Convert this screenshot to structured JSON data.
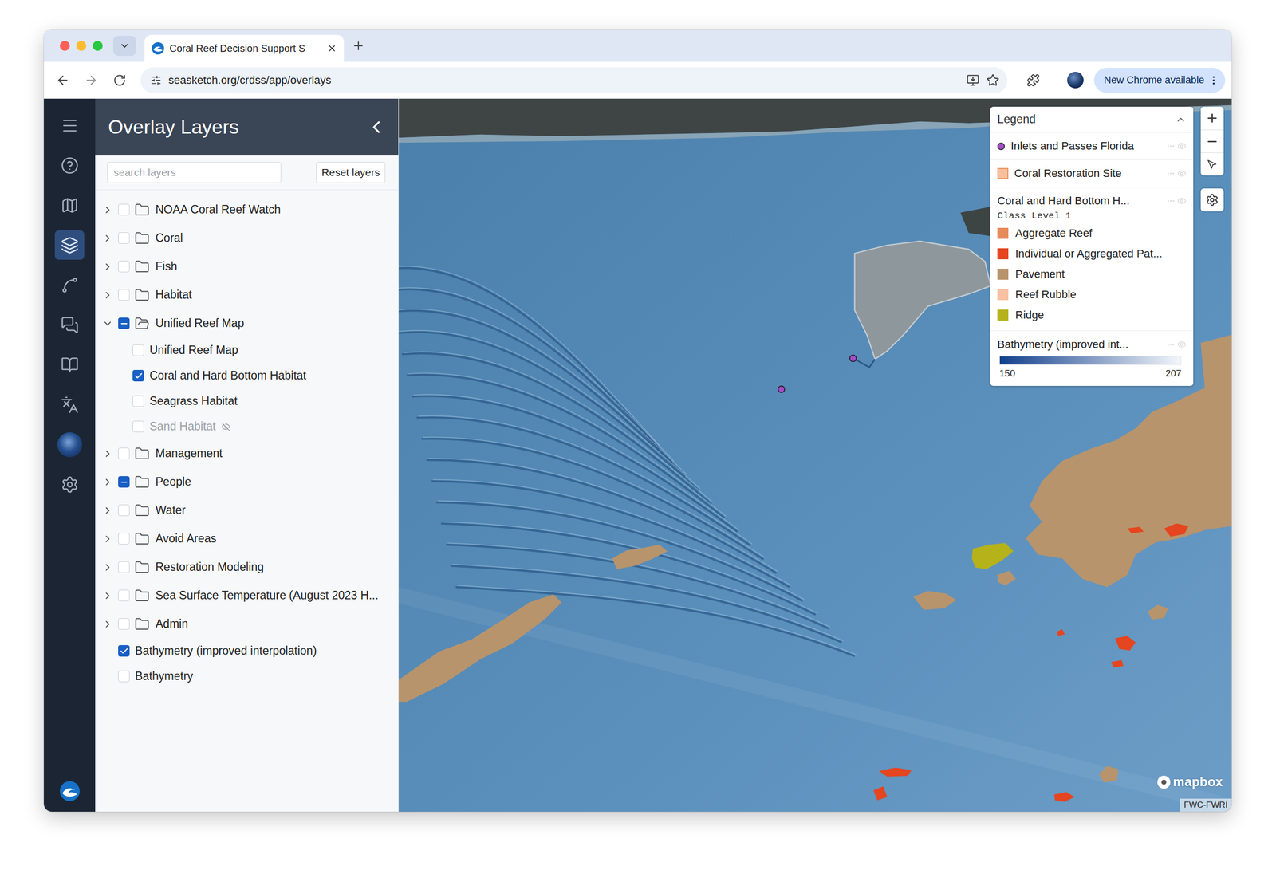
{
  "browser": {
    "tab_title": "Coral Reef Decision Support S",
    "url": "seasketch.org/crdss/app/overlays",
    "update_button": "New Chrome available"
  },
  "rail": {
    "items": [
      {
        "selected": false
      },
      {
        "selected": false
      },
      {
        "selected": false
      },
      {
        "selected": true
      },
      {
        "selected": false
      },
      {
        "selected": false
      },
      {
        "selected": false
      },
      {
        "selected": false
      },
      {
        "selected": false
      },
      {
        "selected": false
      }
    ]
  },
  "panel": {
    "title": "Overlay Layers",
    "search_placeholder": "search layers",
    "reset_button": "Reset layers",
    "layers": [
      {
        "label": "NOAA Coral Reef Watch",
        "kind": "folder",
        "depth": 0,
        "expanded": false,
        "checked": false,
        "partial": false,
        "disabled": false
      },
      {
        "label": "Coral",
        "kind": "folder",
        "depth": 0,
        "expanded": false,
        "checked": false,
        "partial": false,
        "disabled": false
      },
      {
        "label": "Fish",
        "kind": "folder",
        "depth": 0,
        "expanded": false,
        "checked": false,
        "partial": false,
        "disabled": false
      },
      {
        "label": "Habitat",
        "kind": "folder",
        "depth": 0,
        "expanded": false,
        "checked": false,
        "partial": false,
        "disabled": false
      },
      {
        "label": "Unified Reef Map",
        "kind": "folder",
        "depth": 0,
        "expanded": true,
        "checked": false,
        "partial": true,
        "disabled": false
      },
      {
        "label": "Unified Reef Map",
        "kind": "layer",
        "depth": 1,
        "expanded": false,
        "checked": false,
        "partial": false,
        "disabled": false
      },
      {
        "label": "Coral and Hard Bottom Habitat",
        "kind": "layer",
        "depth": 1,
        "expanded": false,
        "checked": true,
        "partial": false,
        "disabled": false
      },
      {
        "label": "Seagrass Habitat",
        "kind": "layer",
        "depth": 1,
        "expanded": false,
        "checked": false,
        "partial": false,
        "disabled": false
      },
      {
        "label": "Sand Habitat",
        "kind": "layer",
        "depth": 1,
        "expanded": false,
        "checked": false,
        "partial": false,
        "disabled": true
      },
      {
        "label": "Management",
        "kind": "folder",
        "depth": 0,
        "expanded": false,
        "checked": false,
        "partial": false,
        "disabled": false
      },
      {
        "label": "People",
        "kind": "folder",
        "depth": 0,
        "expanded": false,
        "checked": false,
        "partial": true,
        "disabled": false
      },
      {
        "label": "Water",
        "kind": "folder",
        "depth": 0,
        "expanded": false,
        "checked": false,
        "partial": false,
        "disabled": false
      },
      {
        "label": "Avoid Areas",
        "kind": "folder",
        "depth": 0,
        "expanded": false,
        "checked": false,
        "partial": false,
        "disabled": false
      },
      {
        "label": "Restoration Modeling",
        "kind": "folder",
        "depth": 0,
        "expanded": false,
        "checked": false,
        "partial": false,
        "disabled": false
      },
      {
        "label": "Sea Surface Temperature (August 2023 H...",
        "kind": "folder",
        "depth": 0,
        "expanded": false,
        "checked": false,
        "partial": false,
        "disabled": false
      },
      {
        "label": "Admin",
        "kind": "folder",
        "depth": 0,
        "expanded": false,
        "checked": false,
        "partial": false,
        "disabled": false
      },
      {
        "label": "Bathymetry (improved interpolation)",
        "kind": "layer",
        "depth": 0,
        "expanded": false,
        "checked": true,
        "partial": false,
        "disabled": false
      },
      {
        "label": "Bathymetry",
        "kind": "layer",
        "depth": 0,
        "expanded": false,
        "checked": false,
        "partial": false,
        "disabled": false
      }
    ]
  },
  "legend": {
    "title": "Legend",
    "expanded": true,
    "items": [
      {
        "kind": "point",
        "label": "Inlets and Passes Florida",
        "color": "#a24fc4"
      },
      {
        "kind": "fill",
        "label": "Coral Restoration Site",
        "color": "#f0965e"
      },
      {
        "kind": "classes",
        "label": "Coral and Hard Bottom H...",
        "subtitle": "Class Level 1",
        "classes": [
          {
            "label": "Aggregate Reef",
            "color": "#e8895a"
          },
          {
            "label": "Individual or Aggregated Pat...",
            "color": "#e5451f"
          },
          {
            "label": "Pavement",
            "color": "#b8946c"
          },
          {
            "label": "Reef Rubble",
            "color": "#f9c0a2"
          },
          {
            "label": "Ridge",
            "color": "#b6b21a"
          }
        ]
      },
      {
        "kind": "gradient",
        "label": "Bathymetry (improved int...",
        "min": "150",
        "max": "207",
        "colors": [
          "#123f8c",
          "#f4f7fb"
        ]
      }
    ]
  },
  "map": {
    "logo": "mapbox",
    "attribution": "FWC-FWRI"
  }
}
